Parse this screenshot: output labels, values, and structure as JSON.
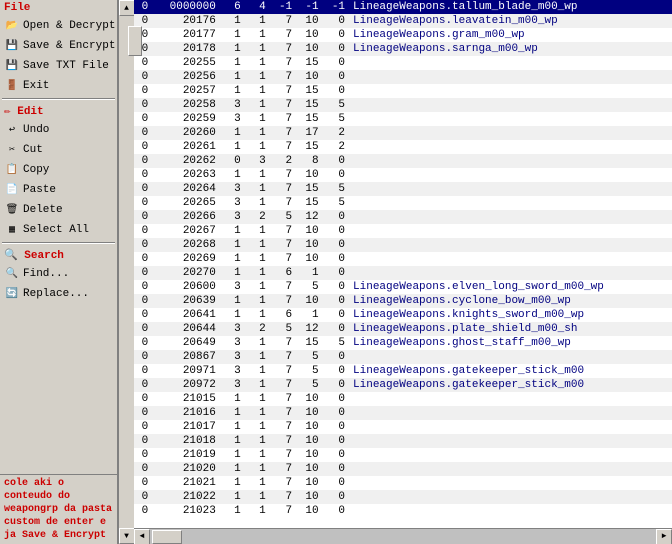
{
  "sidebar": {
    "file_label": "File",
    "items": [
      {
        "id": "open-decrypt",
        "label": "Open & Decrypt",
        "icon": "📂"
      },
      {
        "id": "save-encrypt",
        "label": "Save & Encrypt",
        "icon": "💾"
      },
      {
        "id": "save-txt",
        "label": "Save TXT File",
        "icon": "💾"
      },
      {
        "id": "exit",
        "label": "Exit",
        "icon": "🚪"
      }
    ],
    "edit_label": "Edit",
    "edit_items": [
      {
        "id": "undo",
        "label": "Undo",
        "icon": "↩"
      },
      {
        "id": "cut",
        "label": "Cut",
        "icon": "✂"
      },
      {
        "id": "copy",
        "label": "Copy",
        "icon": "📋"
      },
      {
        "id": "paste",
        "label": "Paste",
        "icon": "📄"
      },
      {
        "id": "delete",
        "label": "Delete",
        "icon": "🗑"
      },
      {
        "id": "select-all",
        "label": "Select All",
        "icon": "▦"
      }
    ],
    "search_label": "Search",
    "search_items": [
      {
        "id": "find",
        "label": "Find...",
        "icon": "🔍"
      },
      {
        "id": "replace",
        "label": "Replace...",
        "icon": "🔄"
      }
    ]
  },
  "status": {
    "message": "cole aki o conteudo do weapongrp da pasta custom de enter e ja Save & Encrypt"
  },
  "table": {
    "headers": [
      "",
      "",
      "",
      "",
      "",
      "",
      "",
      ""
    ],
    "rows": [
      [
        "0",
        "0000000",
        "6",
        "4",
        "-1",
        "-1",
        "-1",
        "LineageWeapons.tallum_blade_m00_wp"
      ],
      [
        "0",
        "20176",
        "1",
        "1",
        "7",
        "10",
        "0",
        "LineageWeapons.leavatein_m00_wp"
      ],
      [
        "0",
        "20177",
        "1",
        "1",
        "7",
        "10",
        "0",
        "LineageWeapons.gram_m00_wp"
      ],
      [
        "0",
        "20178",
        "1",
        "1",
        "7",
        "10",
        "0",
        "LineageWeapons.sarnga_m00_wp"
      ],
      [
        "0",
        "20255",
        "1",
        "1",
        "7",
        "15",
        "0",
        ""
      ],
      [
        "0",
        "20256",
        "1",
        "1",
        "7",
        "10",
        "0",
        ""
      ],
      [
        "0",
        "20257",
        "1",
        "1",
        "7",
        "15",
        "0",
        ""
      ],
      [
        "0",
        "20258",
        "3",
        "1",
        "7",
        "15",
        "5",
        ""
      ],
      [
        "0",
        "20259",
        "3",
        "1",
        "7",
        "15",
        "5",
        ""
      ],
      [
        "0",
        "20260",
        "1",
        "1",
        "7",
        "17",
        "2",
        ""
      ],
      [
        "0",
        "20261",
        "1",
        "1",
        "7",
        "15",
        "2",
        ""
      ],
      [
        "0",
        "20262",
        "0",
        "3",
        "2",
        "8",
        "0",
        ""
      ],
      [
        "0",
        "20263",
        "1",
        "1",
        "7",
        "10",
        "0",
        ""
      ],
      [
        "0",
        "20264",
        "3",
        "1",
        "7",
        "15",
        "5",
        ""
      ],
      [
        "0",
        "20265",
        "3",
        "1",
        "7",
        "15",
        "5",
        ""
      ],
      [
        "0",
        "20266",
        "3",
        "2",
        "5",
        "12",
        "0",
        ""
      ],
      [
        "0",
        "20267",
        "1",
        "1",
        "7",
        "10",
        "0",
        ""
      ],
      [
        "0",
        "20268",
        "1",
        "1",
        "7",
        "10",
        "0",
        ""
      ],
      [
        "0",
        "20269",
        "1",
        "1",
        "7",
        "10",
        "0",
        ""
      ],
      [
        "0",
        "20270",
        "1",
        "1",
        "6",
        "1",
        "0",
        ""
      ],
      [
        "0",
        "20600",
        "3",
        "1",
        "7",
        "5",
        "0",
        "LineageWeapons.elven_long_sword_m00_wp"
      ],
      [
        "0",
        "20639",
        "1",
        "1",
        "7",
        "10",
        "0",
        "LineageWeapons.cyclone_bow_m00_wp"
      ],
      [
        "0",
        "20641",
        "1",
        "1",
        "6",
        "1",
        "0",
        "LineageWeapons.knights_sword_m00_wp"
      ],
      [
        "0",
        "20644",
        "3",
        "2",
        "5",
        "12",
        "0",
        "LineageWeapons.plate_shield_m00_sh"
      ],
      [
        "0",
        "20649",
        "3",
        "1",
        "7",
        "15",
        "5",
        "LineageWeapons.ghost_staff_m00_wp"
      ],
      [
        "0",
        "20867",
        "3",
        "1",
        "7",
        "5",
        "0",
        ""
      ],
      [
        "0",
        "20971",
        "3",
        "1",
        "7",
        "5",
        "0",
        "LineageWeapons.gatekeeper_stick_m00"
      ],
      [
        "0",
        "20972",
        "3",
        "1",
        "7",
        "5",
        "0",
        "LineageWeapons.gatekeeper_stick_m00"
      ],
      [
        "0",
        "21015",
        "1",
        "1",
        "7",
        "10",
        "0",
        ""
      ],
      [
        "0",
        "21016",
        "1",
        "1",
        "7",
        "10",
        "0",
        ""
      ],
      [
        "0",
        "21017",
        "1",
        "1",
        "7",
        "10",
        "0",
        ""
      ],
      [
        "0",
        "21018",
        "1",
        "1",
        "7",
        "10",
        "0",
        ""
      ],
      [
        "0",
        "21019",
        "1",
        "1",
        "7",
        "10",
        "0",
        ""
      ],
      [
        "0",
        "21020",
        "1",
        "1",
        "7",
        "10",
        "0",
        ""
      ],
      [
        "0",
        "21021",
        "1",
        "1",
        "7",
        "10",
        "0",
        ""
      ],
      [
        "0",
        "21022",
        "1",
        "1",
        "7",
        "10",
        "0",
        ""
      ],
      [
        "0",
        "21023",
        "1",
        "1",
        "7",
        "10",
        "0",
        ""
      ]
    ],
    "highlighted_row": 0
  }
}
